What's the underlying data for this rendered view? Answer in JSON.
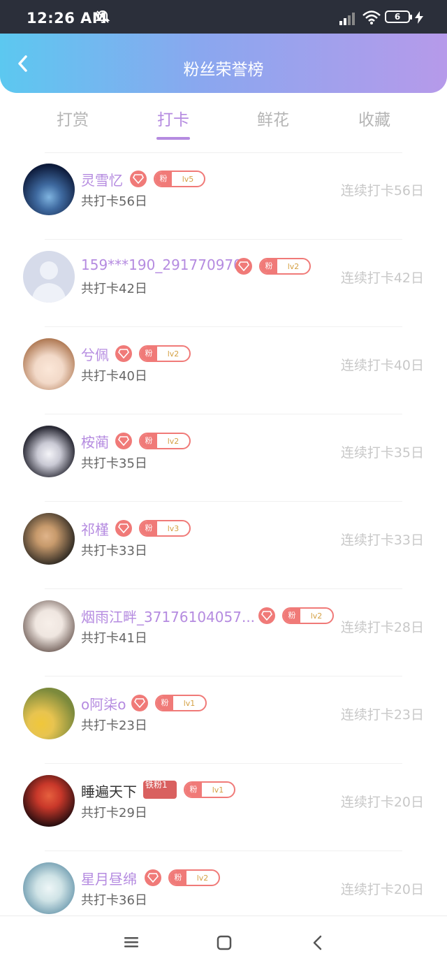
{
  "status_bar": {
    "time": "12:26 AM",
    "battery": "6"
  },
  "header": {
    "title": "粉丝荣誉榜"
  },
  "tabs": [
    {
      "label": "打赏",
      "active": false
    },
    {
      "label": "打卡",
      "active": true
    },
    {
      "label": "鲜花",
      "active": false
    },
    {
      "label": "收藏",
      "active": false
    }
  ],
  "fans": [
    {
      "name": "灵雪忆",
      "total": "共打卡56日",
      "streak": "连续打卡56日",
      "fan_label": "粉",
      "level": "lv5",
      "avatar_colors": [
        "#0d1a3a",
        "#3f6aa0"
      ]
    },
    {
      "name": "159***190_291770970",
      "total": "共打卡42日",
      "streak": "连续打卡42日",
      "fan_label": "粉",
      "level": "lv2",
      "avatar_colors": [
        "#cfd5e6",
        "#b7c0d8"
      ]
    },
    {
      "name": "兮佩",
      "total": "共打卡40日",
      "streak": "连续打卡40日",
      "fan_label": "粉",
      "level": "lv2",
      "avatar_colors": [
        "#f2d9c8",
        "#b07a55"
      ]
    },
    {
      "name": "桉蔺",
      "total": "共打卡35日",
      "streak": "连续打卡35日",
      "fan_label": "粉",
      "level": "lv2",
      "avatar_colors": [
        "#e8e8ee",
        "#2a2a35"
      ]
    },
    {
      "name": "祁槿",
      "total": "共打卡33日",
      "streak": "连续打卡33日",
      "fan_label": "粉",
      "level": "lv3",
      "avatar_colors": [
        "#3a3228",
        "#c79a6c"
      ]
    },
    {
      "name": "烟雨江畔_37176104057...",
      "total": "共打卡41日",
      "streak": "连续打卡28日",
      "fan_label": "粉",
      "level": "lv2",
      "avatar_colors": [
        "#efe6e0",
        "#6d5b55"
      ]
    },
    {
      "name": "o阿柒o",
      "total": "共打卡23日",
      "streak": "连续打卡23日",
      "fan_label": "粉",
      "level": "lv1",
      "avatar_colors": [
        "#e8c450",
        "#7c8a3c"
      ]
    },
    {
      "name": "睡遍天下",
      "total": "共打卡29日",
      "streak": "连续打卡20日",
      "fan_label": "粉",
      "level": "lv1",
      "iron_badge": "铁粉1",
      "avatar_colors": [
        "#2a0e10",
        "#c9382a"
      ]
    },
    {
      "name": "星月昼绵",
      "total": "共打卡36日",
      "streak": "连续打卡20日",
      "fan_label": "粉",
      "level": "lv2",
      "avatar_colors": [
        "#cfe3e6",
        "#5e8fa6"
      ]
    }
  ],
  "colors": {
    "accent": "#b58be0",
    "badge": "#f07a78",
    "level_text": "#d4a043",
    "header_start": "#5cc8f0",
    "header_end": "#b69aea"
  },
  "icons": [
    "bell-off-icon",
    "signal-icon",
    "wifi-icon",
    "battery-icon",
    "charging-icon",
    "back-arrow-icon",
    "gem-icon",
    "menu-icon",
    "home-icon",
    "back-nav-icon"
  ]
}
